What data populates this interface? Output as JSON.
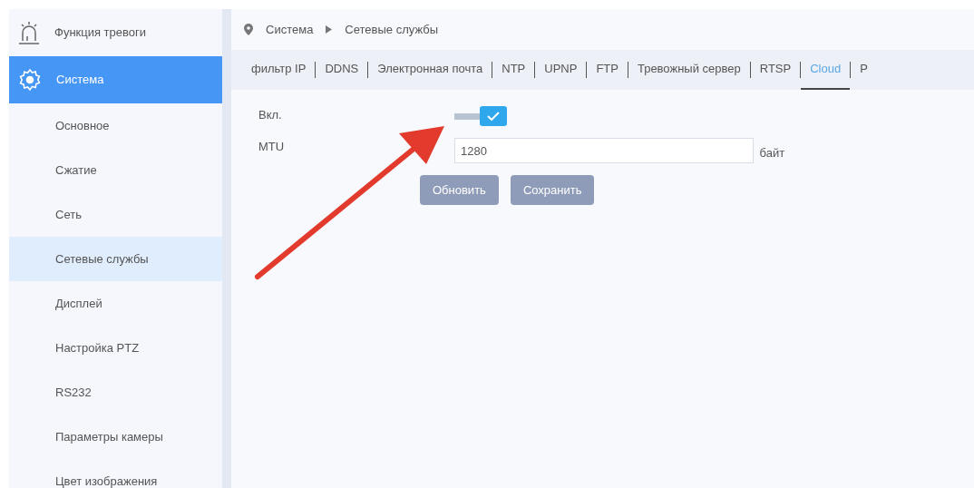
{
  "sidebar": {
    "items": [
      {
        "label": "Функция тревоги",
        "kind": "section",
        "selected": false
      },
      {
        "label": "Система",
        "kind": "section",
        "selected": true
      },
      {
        "label": "Основное",
        "kind": "sub",
        "selected": false
      },
      {
        "label": "Сжатие",
        "kind": "sub",
        "selected": false
      },
      {
        "label": "Сеть",
        "kind": "sub",
        "selected": false
      },
      {
        "label": "Сетевые службы",
        "kind": "sub",
        "selected": true
      },
      {
        "label": "Дисплей",
        "kind": "sub",
        "selected": false
      },
      {
        "label": "Настройка PTZ",
        "kind": "sub",
        "selected": false
      },
      {
        "label": "RS232",
        "kind": "sub",
        "selected": false
      },
      {
        "label": "Параметры камеры",
        "kind": "sub",
        "selected": false
      },
      {
        "label": "Цвет изображения",
        "kind": "sub",
        "selected": false
      }
    ]
  },
  "breadcrumb": [
    "Система",
    "Сетевые службы"
  ],
  "tabs": [
    {
      "label": "фильтр IP",
      "selected": false
    },
    {
      "label": "DDNS",
      "selected": false
    },
    {
      "label": "Электронная почта",
      "selected": false
    },
    {
      "label": "NTP",
      "selected": false
    },
    {
      "label": "UPNP",
      "selected": false
    },
    {
      "label": "FTP",
      "selected": false
    },
    {
      "label": "Тревожный сервер",
      "selected": false
    },
    {
      "label": "RTSP",
      "selected": false
    },
    {
      "label": "Cloud",
      "selected": true
    },
    {
      "label": "P",
      "selected": false
    }
  ],
  "form": {
    "enable": {
      "label": "Вкл.",
      "checked": true
    },
    "mtu": {
      "label": "MTU",
      "value": "1280",
      "unit": "байт"
    },
    "buttons": [
      "Обновить",
      "Сохранить"
    ]
  }
}
